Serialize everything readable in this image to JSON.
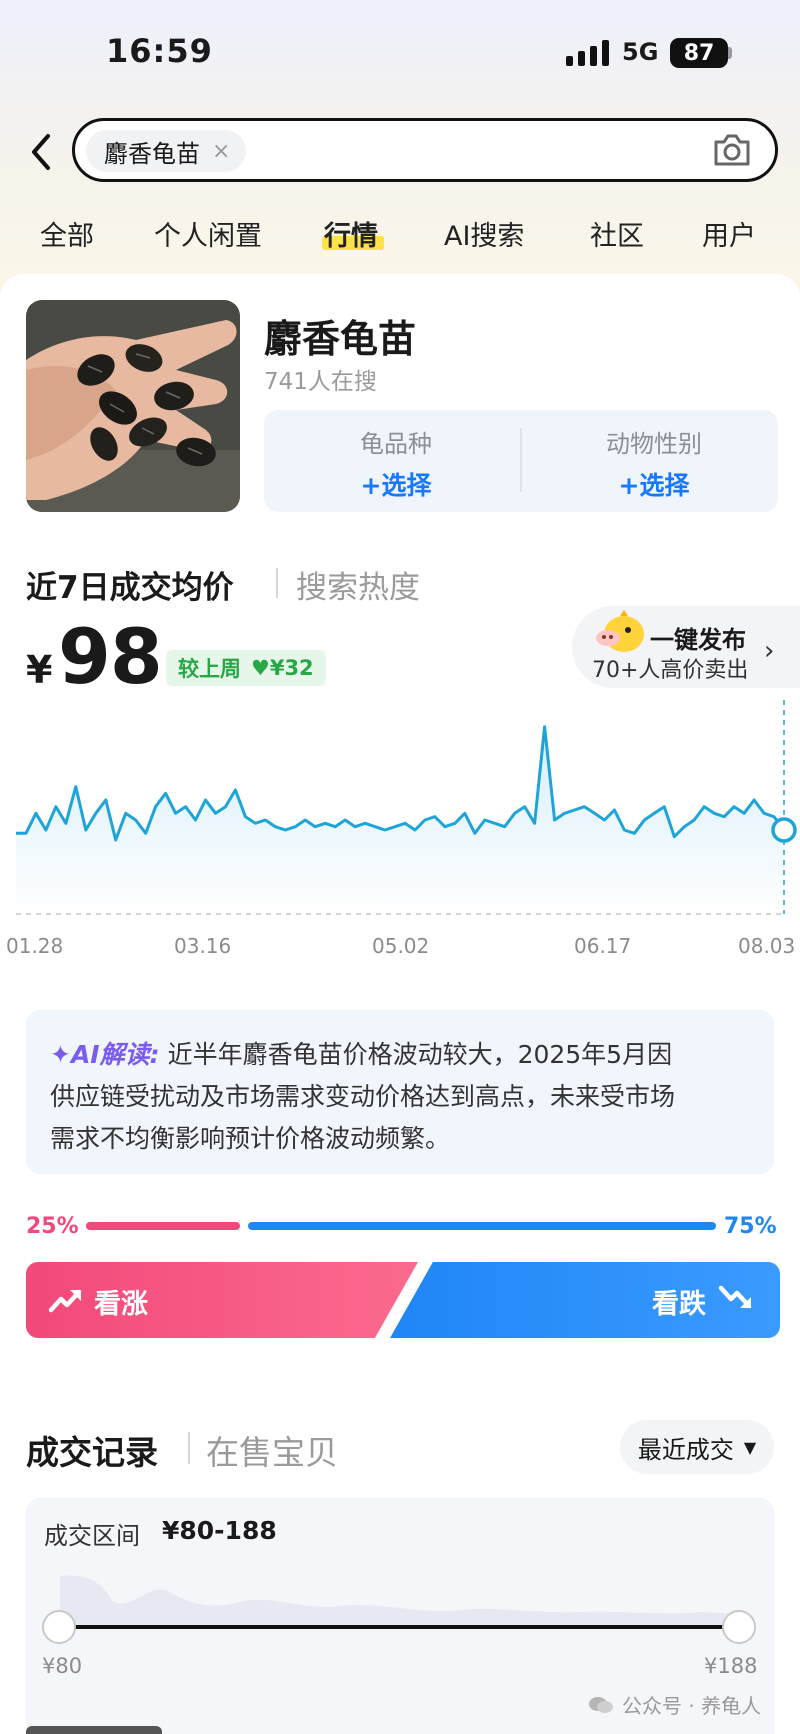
{
  "status_bar": {
    "time": "16:59",
    "network": "5G",
    "battery": "87"
  },
  "search": {
    "query": "麝香龟苗",
    "clear_icon": "×"
  },
  "tabs": [
    {
      "label": "全部"
    },
    {
      "label": "个人闲置"
    },
    {
      "label": "行情",
      "active": true
    },
    {
      "label": "AI搜索"
    },
    {
      "label": "社区"
    },
    {
      "label": "用户"
    }
  ],
  "product": {
    "title": "麝香龟苗",
    "subtitle": "741人在搜",
    "filters": [
      {
        "label": "龟品种",
        "action": "+选择"
      },
      {
        "label": "动物性别",
        "action": "+选择"
      }
    ]
  },
  "price_section": {
    "title": "近7日成交均价",
    "alt_tab": "搜索热度",
    "currency": "¥",
    "price": "98",
    "compare_label": "较上周",
    "compare_value": "♥¥32",
    "publish_title": "一键发布",
    "publish_subtitle": "70+人高价卖出",
    "publish_arrow": "›"
  },
  "chart_data": {
    "type": "line",
    "x_ticks": [
      "01.28",
      "03.16",
      "05.02",
      "06.17",
      "08.03"
    ],
    "note_values_relative": true,
    "series": [
      {
        "values": [
          98,
          98,
          104,
          99,
          106,
          101,
          112,
          99,
          104,
          108,
          96,
          104,
          102,
          98,
          106,
          110,
          104,
          106,
          102,
          108,
          104,
          106,
          111,
          103,
          101,
          102,
          100,
          99,
          100,
          102,
          100,
          101,
          100,
          102,
          100,
          101,
          100,
          99,
          100,
          101,
          99,
          102,
          103,
          100,
          101,
          104,
          98,
          102,
          101,
          100,
          104,
          106,
          101,
          130,
          102,
          104,
          105,
          106,
          104,
          102,
          105,
          99,
          98,
          102,
          104,
          106,
          97,
          100,
          102,
          106,
          104,
          103,
          106,
          104,
          108,
          104,
          103,
          99
        ]
      }
    ],
    "current_value": 98,
    "colors": {
      "line": "#1ea4d8",
      "fill_top": "#d6eefa",
      "fill_bottom": "#ffffff"
    }
  },
  "ai_note": {
    "tag": "✦AI解读:",
    "line1": "近半年麝香龟苗价格波动较大，2025年5月因",
    "line2": "供应链受扰动及市场需求变动价格达到高点，未来受市场",
    "line3": "需求不均衡影响预计价格波动频繁。"
  },
  "vote": {
    "up_percent": "25%",
    "down_percent": "75%",
    "up_label": "看涨",
    "down_label": "看跌",
    "up_ratio": 0.25,
    "down_ratio": 0.75,
    "colors": {
      "up": "#f2497a",
      "down": "#1f86f5"
    }
  },
  "records": {
    "title": "成交记录",
    "alt_tab": "在售宝贝",
    "sort_label": "最近成交",
    "range_label": "成交区间",
    "range_value": "¥80-188",
    "min_label": "¥80",
    "max_label": "¥188"
  },
  "watermark": "公众号 · 养龟人"
}
